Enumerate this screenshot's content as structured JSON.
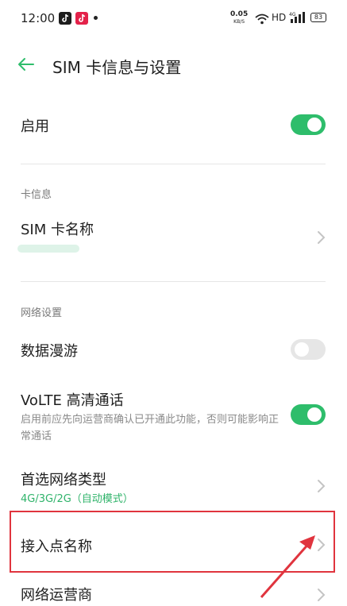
{
  "status_bar": {
    "time": "12:00",
    "net_speed_value": "0.05",
    "net_speed_unit": "KB/S",
    "hd_label": "HD",
    "battery": "83",
    "icons": [
      "tiktok-icon",
      "tiktok-lite-icon",
      "notification-dot",
      "wifi-icon",
      "signal-icon",
      "battery-icon"
    ]
  },
  "header": {
    "title": "SIM 卡信息与设置",
    "back_icon": "arrow-left-icon"
  },
  "enable_row": {
    "label": "启用",
    "toggle_on": true
  },
  "card_info": {
    "section_label": "卡信息",
    "sim_name_label": "SIM 卡名称"
  },
  "network_settings": {
    "section_label": "网络设置",
    "data_roaming": {
      "label": "数据漫游",
      "toggle_on": false
    },
    "volte": {
      "label": "VoLTE 高清通话",
      "description": "启用前应先向运营商确认已开通此功能，否则可能影响正常通话",
      "toggle_on": true
    },
    "preferred_network": {
      "label": "首选网络类型",
      "value": "4G/3G/2G（自动模式）"
    },
    "apn": {
      "label": "接入点名称"
    },
    "carrier": {
      "label": "网络运营商"
    }
  },
  "colors": {
    "accent_green": "#2ebd6b",
    "highlight_red": "#e0343e"
  }
}
